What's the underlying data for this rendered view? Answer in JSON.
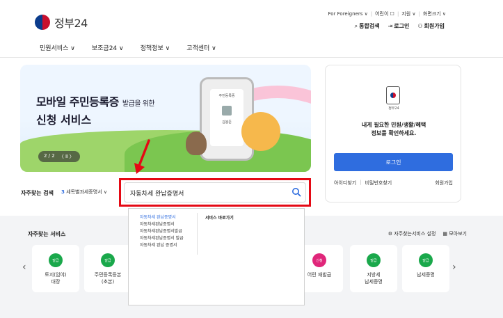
{
  "header": {
    "logo_text": "정부24",
    "util_links": [
      "For Foreigners ∨",
      "어린이 ☐",
      "지원 ∨",
      "화면크기 ∨"
    ],
    "util_actions": [
      {
        "icon": "search-icon",
        "label": "통합검색"
      },
      {
        "icon": "login-icon",
        "label": "로그인"
      },
      {
        "icon": "user-plus-icon",
        "label": "회원가입"
      }
    ]
  },
  "gnb": [
    "민원서비스 ∨",
    "보조금24 ∨",
    "정책정보 ∨",
    "고객센터 ∨"
  ],
  "banner": {
    "title_main": "모바일 주민등록증",
    "title_small": "발급을 위한",
    "title_line2": "신청 서비스",
    "phone_card_title": "주민등록증",
    "phone_card_name": "김봉준",
    "pager": "2 / 2",
    "pager_controls": "〈 Ⅱ 〉"
  },
  "login": {
    "logo_caption": "정부24",
    "message_line1": "내게 필요한 민원/생활/혜택",
    "message_line2": "정보를 확인하세요.",
    "button": "로그인",
    "find_id": "아이디찾기",
    "find_pw": "비밀번호찾기",
    "signup": "회원가입"
  },
  "search": {
    "frequent_label": "자주찾는 검색",
    "frequent_rank": "3",
    "frequent_value": "세목별과세증명서 ∨",
    "input_value": "자동차세 완납증명서"
  },
  "autocomplete": {
    "items": [
      "자동차세 완납증명서",
      "자동차세완납증명서",
      "자동차세완납증명서발급",
      "자동차세완납증명서 발급",
      "자동차세 완납 증명서"
    ],
    "shortcut_label": "서비스 바로가기"
  },
  "services": {
    "title": "자주찾는 서비스",
    "settings": "자주찾는서비스 설정",
    "more": "모아보기",
    "items": [
      {
        "badge": "발급",
        "label": "토지(임야)\n대장",
        "color": "#1aa84b"
      },
      {
        "badge": "발급",
        "label": "주민등록등본\n(초본)",
        "color": "#1aa84b"
      },
      {
        "badge": "신청",
        "label": "어린 재발급",
        "color": "#e0267a"
      },
      {
        "badge": "발급",
        "label": "지방세\n납세증명",
        "color": "#1aa84b"
      },
      {
        "badge": "발급",
        "label": "납세증명",
        "color": "#1aa84b"
      }
    ]
  }
}
